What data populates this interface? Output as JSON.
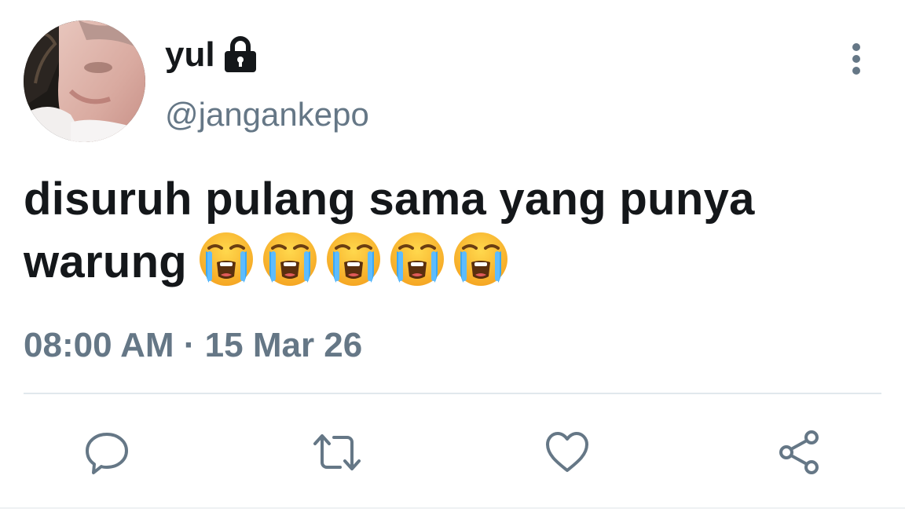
{
  "user": {
    "display_name": "yul",
    "handle": "@jangankepo",
    "protected_icon": "lock-icon",
    "avatar": "profile-photo"
  },
  "tweet": {
    "text_line_1": "disuruh pulang sama yang punya",
    "text_line_2": "warung",
    "emojis": [
      "loudly-crying-face",
      "loudly-crying-face",
      "loudly-crying-face",
      "loudly-crying-face",
      "loudly-crying-face"
    ],
    "timestamp": "08:00 AM · 15 Mar 26"
  },
  "menu": {
    "icon": "more-vertical-icon"
  },
  "actions": [
    {
      "name": "reply",
      "icon": "reply-icon"
    },
    {
      "name": "retweet",
      "icon": "retweet-icon"
    },
    {
      "name": "like",
      "icon": "heart-icon"
    },
    {
      "name": "share",
      "icon": "share-icon"
    }
  ],
  "colors": {
    "text": "#14171a",
    "secondary": "#657786",
    "divider": "#e1e8ed"
  }
}
